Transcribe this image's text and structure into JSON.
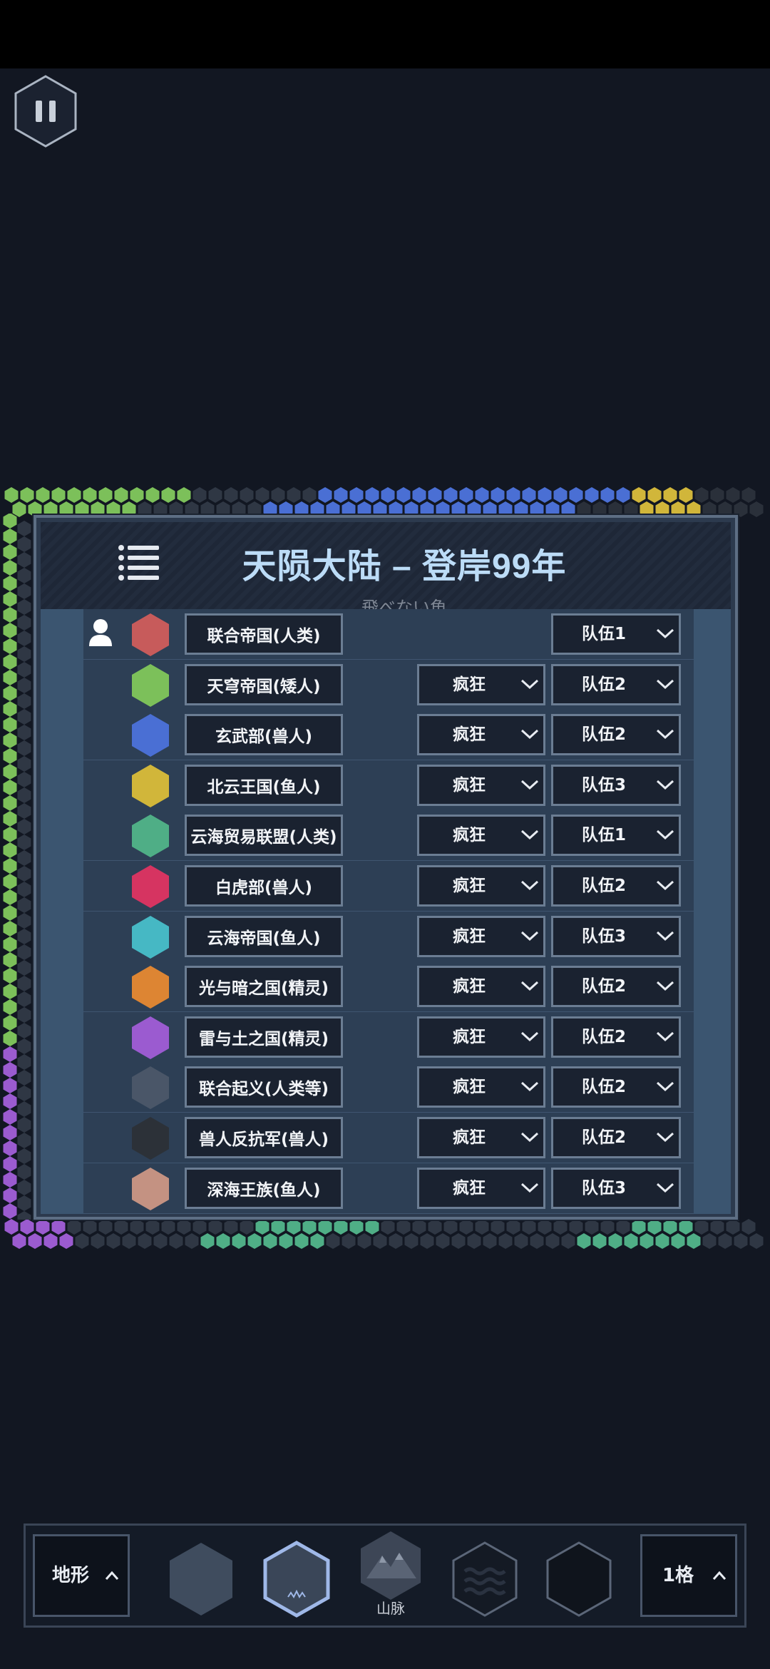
{
  "panel": {
    "title": "天陨大陆 – 登岸99年",
    "subtitle": "飛べない魚"
  },
  "factions": [
    {
      "name": "联合帝国(人类)",
      "color": "#c75b5b",
      "player": true,
      "ai": null,
      "team": "队伍1"
    },
    {
      "name": "天穹帝国(矮人)",
      "color": "#7cc05a",
      "player": false,
      "ai": "疯狂",
      "team": "队伍2"
    },
    {
      "name": "玄武部(兽人)",
      "color": "#4a6fd4",
      "player": false,
      "ai": "疯狂",
      "team": "队伍2"
    },
    {
      "name": "北云王国(鱼人)",
      "color": "#d1b63a",
      "player": false,
      "ai": "疯狂",
      "team": "队伍3"
    },
    {
      "name": "云海贸易联盟(人类)",
      "color": "#4fae86",
      "player": false,
      "ai": "疯狂",
      "team": "队伍1"
    },
    {
      "name": "白虎部(兽人)",
      "color": "#d63461",
      "player": false,
      "ai": "疯狂",
      "team": "队伍2"
    },
    {
      "name": "云海帝国(鱼人)",
      "color": "#46b8c4",
      "player": false,
      "ai": "疯狂",
      "team": "队伍3"
    },
    {
      "name": "光与暗之国(精灵)",
      "color": "#dd8533",
      "player": false,
      "ai": "疯狂",
      "team": "队伍2"
    },
    {
      "name": "雷与土之国(精灵)",
      "color": "#9b5bd0",
      "player": false,
      "ai": "疯狂",
      "team": "队伍2"
    },
    {
      "name": "联合起义(人类等)",
      "color": "#4a5668",
      "player": false,
      "ai": "疯狂",
      "team": "队伍2"
    },
    {
      "name": "兽人反抗军(兽人)",
      "color": "#2c3138",
      "player": false,
      "ai": "疯狂",
      "team": "队伍2"
    },
    {
      "name": "深海王族(鱼人)",
      "color": "#c49282",
      "player": false,
      "ai": "疯狂",
      "team": "队伍3"
    }
  ],
  "toolbar": {
    "terrain_label": "地形",
    "tools": [
      {
        "icon": "plain-hex-icon",
        "label": ""
      },
      {
        "icon": "selected-hex-icon",
        "label": ""
      },
      {
        "icon": "mountain-hex-icon",
        "label": "山脉"
      },
      {
        "icon": "water-hex-icon",
        "label": ""
      },
      {
        "icon": "empty-hex-icon",
        "label": ""
      }
    ],
    "brush_label": "1格"
  }
}
